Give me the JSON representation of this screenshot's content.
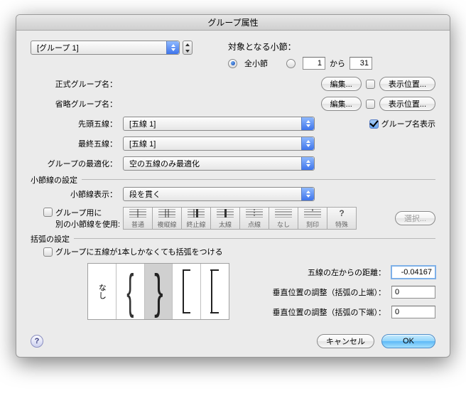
{
  "title": "グループ属性",
  "group_selector": {
    "value": "[グループ 1]"
  },
  "target": {
    "heading": "対象となる小節：",
    "opt_all": "全小節",
    "from": "1",
    "to_label": "から",
    "to": "31",
    "selected": "all"
  },
  "full_name_label": "正式グループ名：",
  "abbr_name_label": "省略グループ名：",
  "edit_btn": "編集...",
  "position_btn": "表示位置...",
  "show_name_cb": "グループ名表示",
  "top_staff_label": "先頭五線：",
  "bottom_staff_label": "最終五線：",
  "staff_1": "[五線 1]",
  "optimize_label": "グループの最適化：",
  "optimize_value": "空の五線のみ最適化",
  "barline": {
    "section": "小節線の設定",
    "display_label": "小節線表示：",
    "display_value": "段を貫く",
    "alt_cb_line1": "グループ用に",
    "alt_cb_line2": "別の小節線を使用:",
    "options": [
      "普通",
      "複縦線",
      "終止線",
      "太線",
      "点線",
      "なし",
      "刻印",
      "特殊"
    ],
    "select_btn": "選択..."
  },
  "bracket": {
    "section": "括弧の設定",
    "always_cb": "グループに五線が1本しかなくても括弧をつける",
    "none_label": "なし",
    "left_dist_label": "五線の左からの距離：",
    "left_dist_value": "-0.04167",
    "top_adj_label": "垂直位置の調整（括弧の上端）：",
    "top_adj_value": "0",
    "bot_adj_label": "垂直位置の調整（括弧の下端）：",
    "bot_adj_value": "0"
  },
  "cancel": "キャンセル",
  "ok": "OK"
}
